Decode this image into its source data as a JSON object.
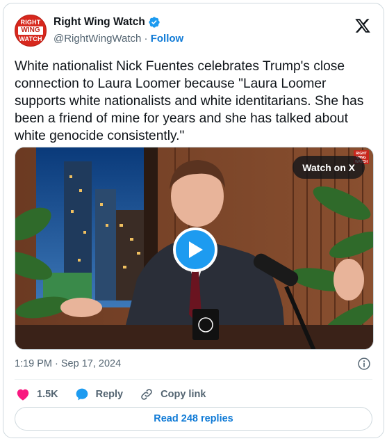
{
  "account": {
    "name": "Right Wing Watch",
    "handle": "@RightWingWatch",
    "separator": "·",
    "follow_label": "Follow",
    "avatar_lines": [
      "RIGHT",
      "WING",
      "WATCH"
    ]
  },
  "tweet": {
    "text": "White nationalist Nick Fuentes celebrates Trump's close connection to Laura Loomer because \"Laura Loomer supports white nationalists and white identitarians. She has been a friend of mine for years and she has talked about white genocide consistently.\"",
    "timestamp": "1:19 PM · Sep 17, 2024"
  },
  "media": {
    "watch_label": "Watch on X",
    "mug_logo": "AF",
    "corner_logo_lines": [
      "RIGHT",
      "WING",
      "WATCH"
    ]
  },
  "actions": {
    "likes_count": "1.5K",
    "reply_label": "Reply",
    "copy_link_label": "Copy link"
  },
  "footer": {
    "read_replies_label": "Read 248 replies"
  },
  "colors": {
    "accent": "#1d9bf0",
    "link": "#0f7ad6",
    "heart": "#f91880",
    "muted": "#536471"
  }
}
